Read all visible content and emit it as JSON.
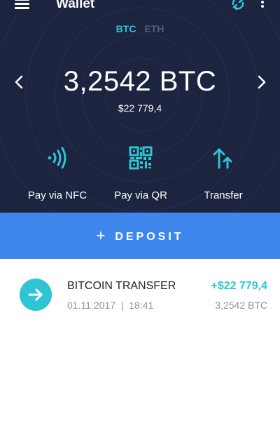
{
  "header": {
    "title": "Wallet",
    "menu_icon": "hamburger-menu-icon",
    "sync_icon": "sync-icon",
    "more_icon": "kebab-menu-icon"
  },
  "currency_tabs": [
    {
      "label": "BTC",
      "active": true
    },
    {
      "label": "ETH",
      "active": false
    }
  ],
  "balance": {
    "amount": "3,2542 BTC",
    "fiat": "$22 779,4"
  },
  "actions": [
    {
      "label": "Pay via NFC",
      "icon": "nfc-icon"
    },
    {
      "label": "Pay via QR",
      "icon": "qr-code-icon"
    },
    {
      "label": "Transfer",
      "icon": "transfer-icon"
    }
  ],
  "deposit": {
    "label": "DEPOSIT",
    "icon": "plus-icon"
  },
  "transactions": [
    {
      "title": "BITCOIN TRANSFER",
      "date": "01.11.2017",
      "separator": "|",
      "time": "18:41",
      "amount": "+$22 779,4",
      "crypto": "3,2542 BTC",
      "icon": "arrow-right-icon"
    }
  ],
  "colors": {
    "hero_background": "#1c2440",
    "accent": "#2ec4d3",
    "deposit": "#3d87ec",
    "inactive_tab": "#56607a",
    "muted_text": "#8d93a3"
  }
}
